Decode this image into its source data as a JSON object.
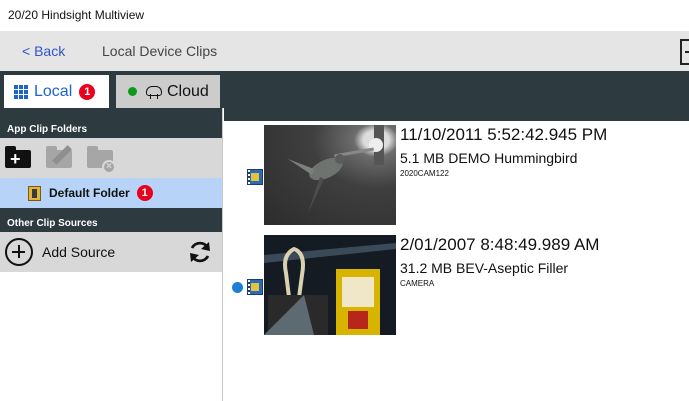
{
  "window": {
    "title": "20/20 Hindsight Multiview"
  },
  "nav": {
    "back_label": "< Back",
    "page_title": "Local Device Clips"
  },
  "tabs": [
    {
      "label": "Local",
      "badge": "1",
      "active": true,
      "icon": "grid-icon"
    },
    {
      "label": "Cloud",
      "status_color": "#0d9a1a",
      "icon": "cloud-icon"
    }
  ],
  "sidebar": {
    "app_folders_header": "App Clip Folders",
    "toolbar": [
      "add-folder-icon",
      "edit-folder-icon",
      "remove-folder-icon"
    ],
    "folders": [
      {
        "label": "Default Folder",
        "badge": "1"
      }
    ],
    "sources_header": "Other Clip Sources",
    "add_source_label": "Add Source"
  },
  "clips": [
    {
      "datetime": "11/10/2011 5:52:42.945 PM",
      "size": "5.1 MB",
      "name": "DEMO Hummingbird",
      "source": "2020CAM122",
      "selected": false
    },
    {
      "datetime": "2/01/2007 8:48:49.989 AM",
      "size": "31.2 MB",
      "name": "BEV-Aseptic Filler",
      "source": "CAMERA",
      "selected": true
    }
  ],
  "colors": {
    "accent": "#1c64c9",
    "header_bg": "#2d3a40",
    "badge": "#e8001c",
    "selection": "#b7d3f8"
  }
}
